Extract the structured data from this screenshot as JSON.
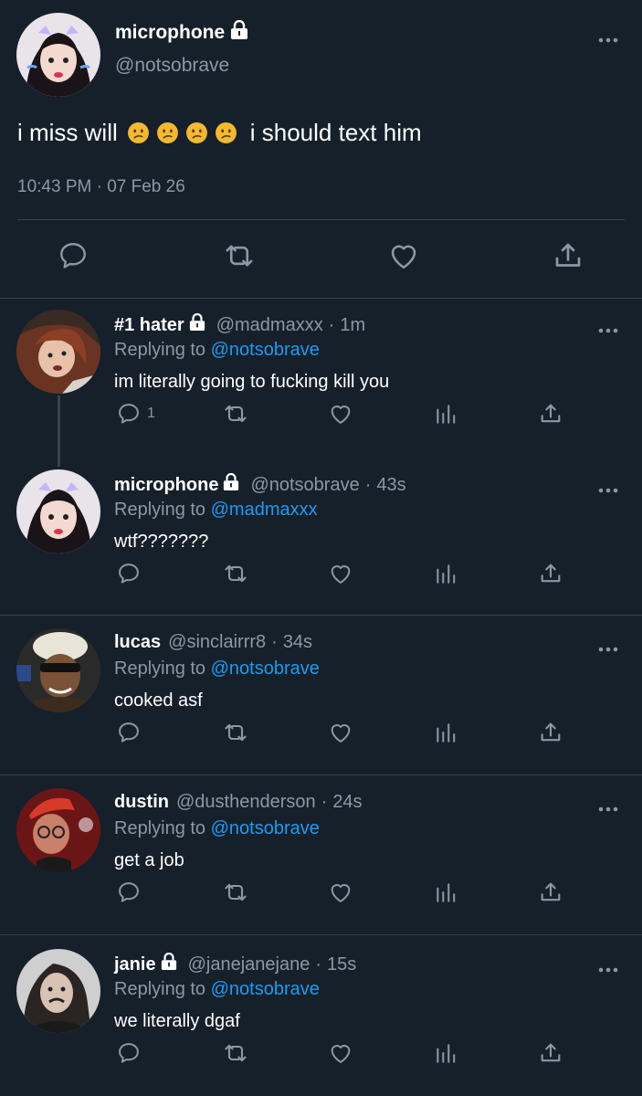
{
  "theme": {
    "background": "#15202b",
    "text": "#ffffff",
    "muted": "#8b98a5",
    "link": "#1d9bf0",
    "divider": "#38444d",
    "emoji": "#f5b92f"
  },
  "main_tweet": {
    "name": "microphone",
    "handle": "@notsobrave",
    "text_before": "i miss will",
    "emojis": [
      "confused-face",
      "confused-face",
      "confused-face",
      "confused-face"
    ],
    "text_after": "i should text him",
    "timestamp": "10:43 PM · 07 Feb 26"
  },
  "replies": [
    {
      "name": "#1 hater",
      "locked": true,
      "handle": "@madmaxxx",
      "time": "1m",
      "replying_label": "Replying to",
      "replying_to": "@notsobrave",
      "text": "im literally going to fucking kill you",
      "reply_count": "1"
    },
    {
      "name": "microphone",
      "locked": true,
      "handle": "@notsobrave",
      "time": "43s",
      "replying_label": "Replying to",
      "replying_to": "@madmaxxx",
      "text": "wtf???????",
      "reply_count": ""
    },
    {
      "name": "lucas",
      "locked": false,
      "handle": "@sinclairrr8",
      "time": "34s",
      "replying_label": "Replying to",
      "replying_to": "@notsobrave",
      "text": "cooked asf",
      "reply_count": ""
    },
    {
      "name": "dustin",
      "locked": false,
      "handle": "@dusthenderson",
      "time": "24s",
      "replying_label": "Replying to",
      "replying_to": "@notsobrave",
      "text": "get a job",
      "reply_count": ""
    },
    {
      "name": "janie",
      "locked": true,
      "handle": "@janejanejane",
      "time": "15s",
      "replying_label": "Replying to",
      "replying_to": "@notsobrave",
      "text": "we literally dgaf",
      "reply_count": ""
    }
  ],
  "separator": "·"
}
